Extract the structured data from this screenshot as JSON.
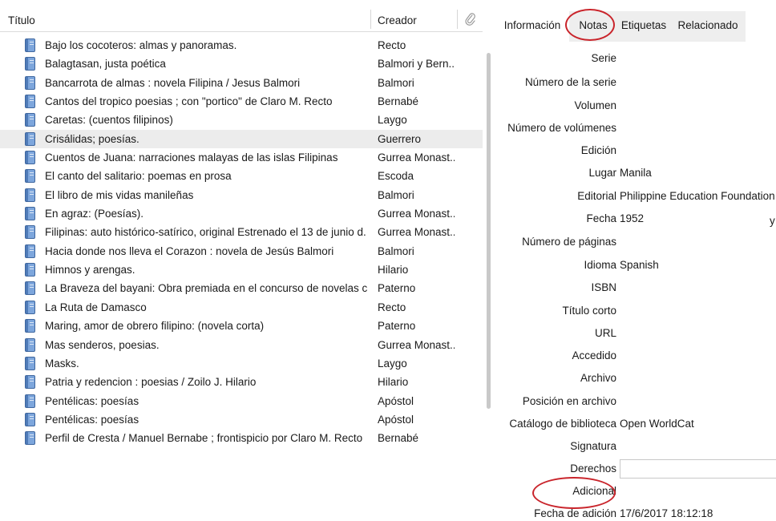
{
  "list": {
    "columns": {
      "title": "Título",
      "creator": "Creador",
      "attachment_icon": "paperclip-icon"
    },
    "selected_index": 5,
    "items": [
      {
        "title": "Bajo los cocoteros: almas y panoramas.",
        "creator": "Recto"
      },
      {
        "title": "Balagtasan, justa poética",
        "creator": "Balmori y Bern..."
      },
      {
        "title": "Bancarrota de almas : novela Filipina / Jesus Balmori",
        "creator": "Balmori"
      },
      {
        "title": "Cantos del tropico poesias ; con \"portico\" de Claro M. Recto",
        "creator": "Bernabé"
      },
      {
        "title": "Caretas: (cuentos filipinos)",
        "creator": "Laygo"
      },
      {
        "title": "Crisálidas; poesías.",
        "creator": "Guerrero"
      },
      {
        "title": "Cuentos de Juana: narraciones malayas de las islas Filipinas",
        "creator": "Gurrea Monast..."
      },
      {
        "title": "El canto del salitario: poemas en prosa",
        "creator": "Escoda"
      },
      {
        "title": "El libro de mis vidas manileñas",
        "creator": "Balmori"
      },
      {
        "title": "En agraz: (Poesías).",
        "creator": "Gurrea Monast..."
      },
      {
        "title": "Filipinas: auto histórico-satírico, original Estrenado el 13 de junio d...",
        "creator": "Gurrea Monast..."
      },
      {
        "title": "Hacia donde nos lleva el Corazon : novela de Jesús Balmori",
        "creator": "Balmori"
      },
      {
        "title": "Himnos y arengas.",
        "creator": "Hilario"
      },
      {
        "title": "La Braveza del bayani: Obra premiada en el concurso de novelas c...",
        "creator": "Paterno"
      },
      {
        "title": "La Ruta de Damasco",
        "creator": "Recto"
      },
      {
        "title": "Maring, amor de obrero filipino: (novela corta)",
        "creator": "Paterno"
      },
      {
        "title": "Mas senderos, poesias.",
        "creator": "Gurrea Monast..."
      },
      {
        "title": "Masks.",
        "creator": "Laygo"
      },
      {
        "title": "Patria y redencion : poesias / Zoilo J. Hilario",
        "creator": "Hilario"
      },
      {
        "title": "Pentélicas: poesías",
        "creator": "Apóstol"
      },
      {
        "title": "Pentélicas: poesías",
        "creator": "Apóstol"
      },
      {
        "title": "Perfil de Cresta / Manuel Bernabe ; frontispicio por Claro M. Recto",
        "creator": "Bernabé"
      }
    ]
  },
  "details": {
    "tabs": {
      "info": "Información",
      "notes": "Notas",
      "tags": "Etiquetas",
      "related": "Relacionado"
    },
    "fields": {
      "serie": {
        "label": "Serie",
        "value": ""
      },
      "numero_serie": {
        "label": "Número de la serie",
        "value": ""
      },
      "volumen": {
        "label": "Volumen",
        "value": ""
      },
      "num_volumenes": {
        "label": "Número de volúmenes",
        "value": ""
      },
      "edicion": {
        "label": "Edición",
        "value": ""
      },
      "lugar": {
        "label": "Lugar",
        "value": "Manila"
      },
      "editorial": {
        "label": "Editorial",
        "value": "Philippine Education Foundation"
      },
      "fecha": {
        "label": "Fecha",
        "value": "1952"
      },
      "num_paginas": {
        "label": "Número de páginas",
        "value": ""
      },
      "idioma": {
        "label": "Idioma",
        "value": "Spanish"
      },
      "isbn": {
        "label": "ISBN",
        "value": ""
      },
      "titulo_corto": {
        "label": "Título corto",
        "value": ""
      },
      "url": {
        "label": "URL",
        "value": ""
      },
      "accedido": {
        "label": "Accedido",
        "value": ""
      },
      "archivo": {
        "label": "Archivo",
        "value": ""
      },
      "posicion_archivo": {
        "label": "Posición en archivo",
        "value": ""
      },
      "catalogo": {
        "label": "Catálogo de biblioteca",
        "value": "Open WorldCat"
      },
      "signatura": {
        "label": "Signatura",
        "value": ""
      },
      "derechos": {
        "label": "Derechos",
        "value": ""
      },
      "adicional": {
        "label": "Adicional",
        "value": ""
      },
      "fecha_adicion": {
        "label": "Fecha de adición",
        "value": "17/6/2017 18:12:18"
      }
    },
    "fecha_stray": "y"
  },
  "annotation_color": "#c9242b",
  "selection_color": "#ececec"
}
